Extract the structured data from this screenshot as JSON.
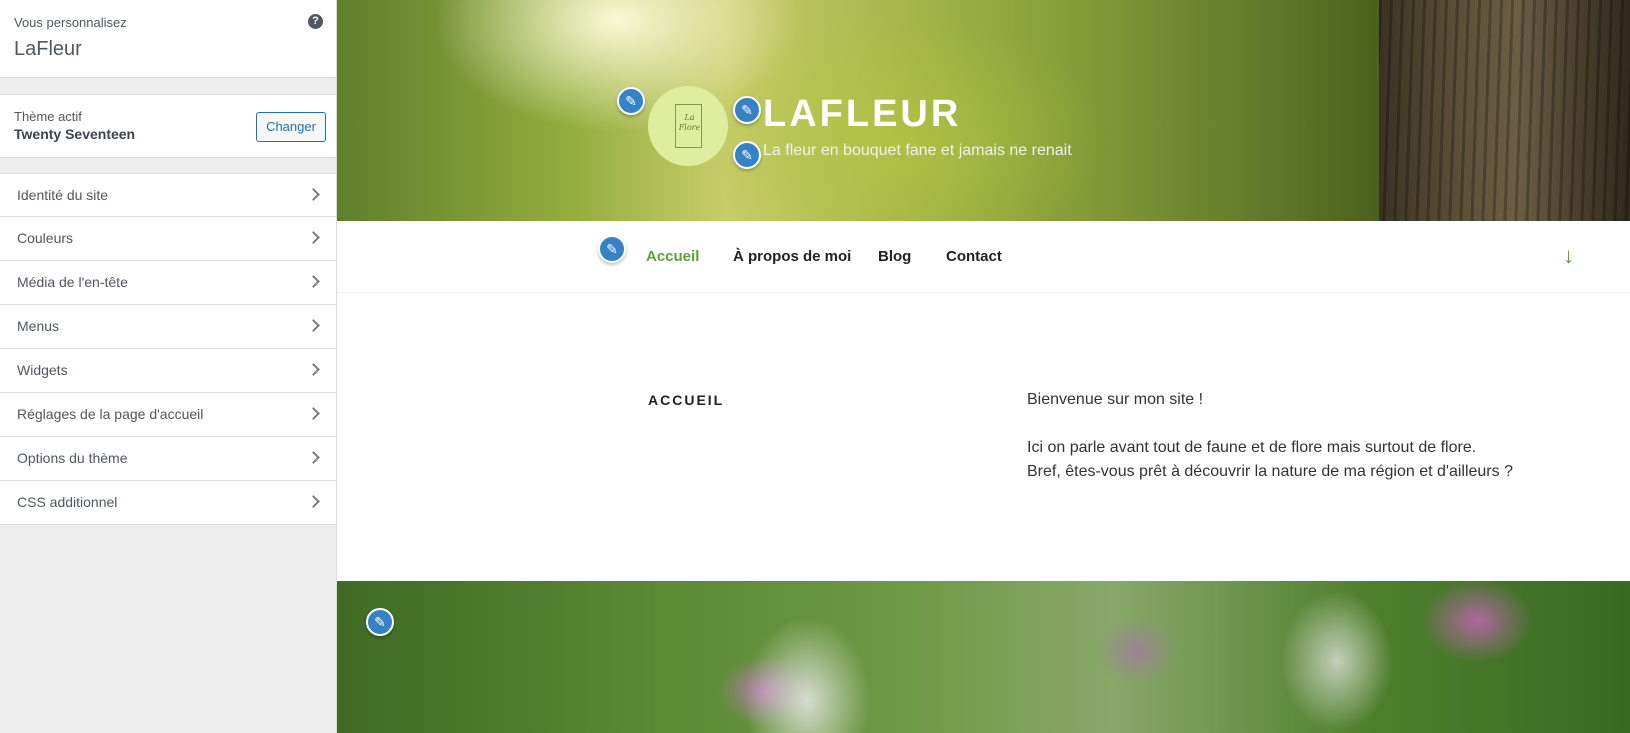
{
  "sidebar": {
    "customizing_label": "Vous personnalisez",
    "site_name": "LaFleur",
    "help_icon": "?",
    "active_theme_label": "Thème actif",
    "theme_name": "Twenty Seventeen",
    "change_button": "Changer",
    "items": [
      {
        "label": "Identité du site"
      },
      {
        "label": "Couleurs"
      },
      {
        "label": "Média de l'en-tête"
      },
      {
        "label": "Menus"
      },
      {
        "label": "Widgets"
      },
      {
        "label": "Réglages de la page d'accueil"
      },
      {
        "label": "Options du thème"
      },
      {
        "label": "CSS additionnel"
      }
    ]
  },
  "preview": {
    "site_title": "LAFLEUR",
    "tagline": "La fleur en bouquet fane et jamais ne renait",
    "logo_text": "La Flore",
    "nav": {
      "items": [
        "Accueil",
        "À propos de moi",
        "Blog",
        "Contact"
      ],
      "active": "Accueil",
      "scroll_icon": "arrow-down-icon"
    },
    "page_heading": "ACCUEIL",
    "content": {
      "welcome": "Bienvenue sur mon site !",
      "line1": "Ici on parle avant tout de faune et de flore mais surtout de flore.",
      "line2": "Bref, êtes-vous prêt à découvrir la nature de ma région et d'ailleurs ?"
    }
  },
  "colors": {
    "accent_green": "#5f9e3a",
    "edit_shortcut_blue": "#3582c4",
    "wp_button_blue": "#2271b1"
  }
}
